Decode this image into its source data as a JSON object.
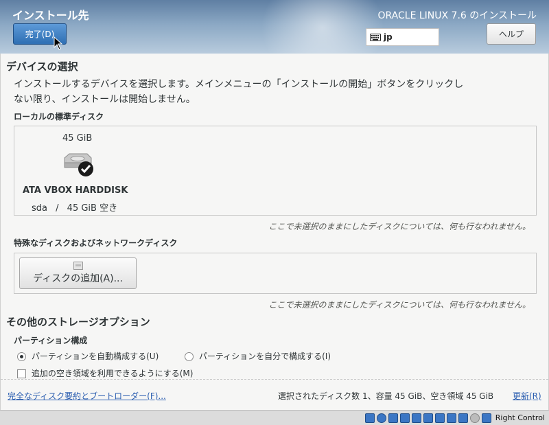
{
  "header": {
    "spoke_title": "インストール先",
    "done_label": "完了(D)",
    "product_title": "ORACLE LINUX 7.6 のインストール",
    "keyboard_layout": "jp",
    "help_label": "ヘルプ"
  },
  "device_selection": {
    "title": "デバイスの選択",
    "description_line1": "インストールするデバイスを選択します。メインメニューの「インストールの開始」ボタンをクリックし",
    "description_line2": "ない限り、インストールは開始しません。"
  },
  "local_disks": {
    "title": "ローカルの標準ディスク",
    "disk": {
      "size": "45 GiB",
      "name": "ATA VBOX HARDDISK",
      "device": "sda",
      "separator": "/",
      "free": "45 GiB 空き",
      "selected": true
    },
    "note": "ここで未選択のままにしたディスクについては、何も行なわれません。"
  },
  "specialized_disks": {
    "title": "特殊なディスクおよびネットワークディスク",
    "add_disk_label": "ディスクの追加(A)...",
    "note": "ここで未選択のままにしたディスクについては、何も行なわれません。"
  },
  "other_options": {
    "title": "その他のストレージオプション",
    "partitioning_title": "パーティション構成",
    "auto_label": "パーティションを自動構成する(U)",
    "manual_label": "パーティションを自分で構成する(I)",
    "auto_selected": true,
    "reclaim_label": "追加の空き領域を利用できるようにする(M)",
    "reclaim_checked": false
  },
  "footer": {
    "summary_link": "完全なディスク要約とブートローダー(F)...",
    "summary_text": "選択されたディスク数 1、容量 45 GiB、空き領域 45 GiB",
    "refresh_link": "更新(R)"
  },
  "statusbar": {
    "host_key": "Right Control"
  },
  "colors": {
    "header_top": "#5f7fa3",
    "done_button": "#2f6fb3",
    "link": "#2a5db0"
  }
}
